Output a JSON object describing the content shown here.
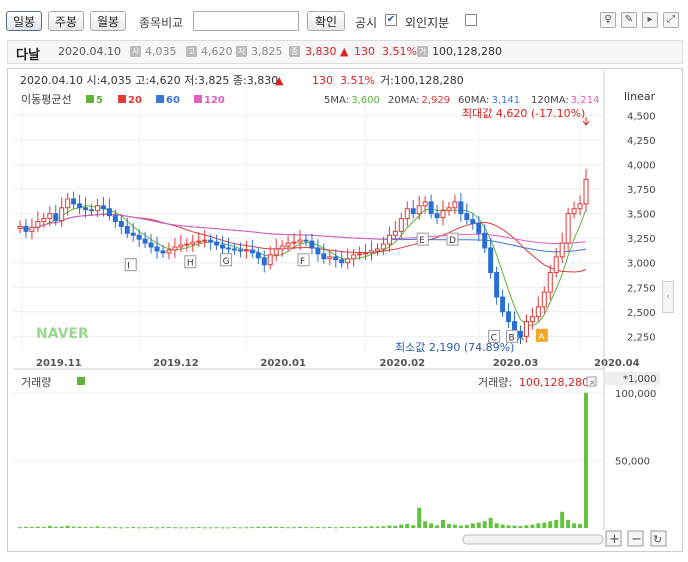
{
  "toolbar": {
    "period_tabs": [
      "일봉",
      "주봉",
      "월봉"
    ],
    "compare_label": "종목비교",
    "confirm_label": "확인",
    "disclosure_label": "공시",
    "foreign_label": "외인지분"
  },
  "info_bar": {
    "name": "다날",
    "date": "2020.04.10",
    "open": "4,035",
    "high": "4,620",
    "low": "3,825",
    "close": "3,830",
    "change_arrow": "▲",
    "change": "130",
    "change_pct": "3.51%",
    "volume": "100,128,280"
  },
  "chart_header": {
    "text": "2020.04.10 시:4,035 고:4,620 저:3,825 종:3,830",
    "arrow": "▲",
    "change": "130",
    "change_pct": "3.51%",
    "volume_text": "거:100,128,280",
    "scale_label": "linear"
  },
  "ma_legend": {
    "title": "이동평균선",
    "items": [
      {
        "label": "5",
        "color": "#5fb33a"
      },
      {
        "label": "20",
        "color": "#e03a3a"
      },
      {
        "label": "60",
        "color": "#3a78d8"
      },
      {
        "label": "120",
        "color": "#e060c0"
      }
    ],
    "values": [
      {
        "label": "5MA:",
        "value": "3,600",
        "color": "#5fb33a"
      },
      {
        "label": "20MA:",
        "value": "2,929",
        "color": "#e03a3a"
      },
      {
        "label": "60MA:",
        "value": "3,141",
        "color": "#3a78d8"
      },
      {
        "label": "120MA:",
        "value": "3,214",
        "color": "#e060c0"
      }
    ]
  },
  "annotations": {
    "max_label": "최대값 4,620 (-17.10%)",
    "min_label": "최소값 2,190 (74.89%)",
    "volume_label": "거래량",
    "volume_value_label": "거래량:",
    "volume_value": "100,128,280",
    "volume_unit": "*1,000",
    "logo": "NAVER",
    "event_markers": [
      "I",
      "H",
      "G",
      "F",
      "E",
      "D",
      "C",
      "B",
      "A"
    ]
  },
  "chart_data": {
    "type": "candlestick",
    "price_ticks": [
      "4,500",
      "4,250",
      "4,000",
      "3,750",
      "3,500",
      "3,250",
      "3,000",
      "2,750",
      "2,500",
      "2,250"
    ],
    "price_tick_values": [
      4500,
      4250,
      4000,
      3750,
      3500,
      3250,
      3000,
      2750,
      2500,
      2250
    ],
    "ylim": [
      2080,
      4760
    ],
    "x_ticks": [
      "2019.11",
      "2019.12",
      "2020.01",
      "2020.02",
      "2020.03",
      "2020.04"
    ],
    "volume_ticks": [
      "100,000",
      "50,000"
    ],
    "volume_tick_values": [
      100000,
      50000
    ],
    "volume_ylim": [
      0,
      100000
    ],
    "closes": [
      3370,
      3320,
      3360,
      3420,
      3450,
      3500,
      3430,
      3560,
      3650,
      3600,
      3560,
      3540,
      3530,
      3580,
      3550,
      3480,
      3420,
      3370,
      3300,
      3280,
      3240,
      3200,
      3160,
      3120,
      3100,
      3130,
      3160,
      3180,
      3190,
      3210,
      3220,
      3230,
      3210,
      3180,
      3150,
      3140,
      3130,
      3120,
      3130,
      3100,
      3050,
      2980,
      3080,
      3140,
      3170,
      3200,
      3210,
      3230,
      3220,
      3150,
      3090,
      3040,
      3060,
      3030,
      3000,
      3040,
      3080,
      3090,
      3100,
      3120,
      3140,
      3190,
      3280,
      3320,
      3450,
      3550,
      3500,
      3580,
      3620,
      3500,
      3460,
      3530,
      3560,
      3620,
      3500,
      3440,
      3400,
      3300,
      3150,
      2900,
      2650,
      2500,
      2400,
      2300,
      2250,
      2400,
      2450,
      2550,
      2700,
      2900,
      3060,
      3200,
      3500,
      3550,
      3600,
      3850
    ],
    "volumes": [
      600,
      800,
      700,
      900,
      700,
      1500,
      900,
      1100,
      1600,
      1000,
      900,
      800,
      700,
      1200,
      700,
      600,
      800,
      500,
      600,
      700,
      500,
      600,
      700,
      500,
      600,
      700,
      600,
      500,
      500,
      600,
      700,
      500,
      500,
      600,
      500,
      500,
      700,
      500,
      600,
      700,
      900,
      800,
      1000,
      900,
      700,
      600,
      600,
      800,
      700,
      600,
      700,
      600,
      800,
      600,
      900,
      700,
      800,
      900,
      1000,
      1200,
      1100,
      1300,
      1800,
      1500,
      2500,
      3000,
      2000,
      15000,
      5000,
      3500,
      2000,
      6000,
      3000,
      2500,
      1800,
      2200,
      3500,
      4000,
      5000,
      7500,
      3500,
      2500,
      2000,
      1800,
      1500,
      2000,
      2500,
      3500,
      4000,
      5000,
      6000,
      12000,
      6000,
      3500,
      3000,
      100128
    ]
  }
}
